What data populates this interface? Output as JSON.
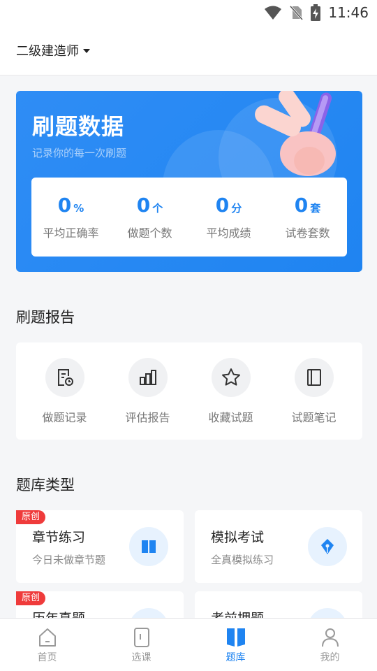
{
  "status_bar": {
    "time": "11:46",
    "icons": [
      "wifi-icon",
      "no-sim-icon",
      "battery-charging-icon"
    ]
  },
  "header": {
    "exam_name": "二级建造师"
  },
  "hero": {
    "title": "刷题数据",
    "subtitle": "记录你的每一次刷题",
    "stats": [
      {
        "value": "0",
        "unit": "%",
        "label": "平均正确率"
      },
      {
        "value": "0",
        "unit": "个",
        "label": "做题个数"
      },
      {
        "value": "0",
        "unit": "分",
        "label": "平均成绩"
      },
      {
        "value": "0",
        "unit": "套",
        "label": "试卷套数"
      }
    ]
  },
  "report": {
    "title": "刷题报告",
    "items": [
      {
        "label": "做题记录",
        "icon": "record-icon"
      },
      {
        "label": "评估报告",
        "icon": "bar-chart-icon"
      },
      {
        "label": "收藏试题",
        "icon": "star-icon"
      },
      {
        "label": "试题笔记",
        "icon": "notebook-icon"
      }
    ]
  },
  "bank_types": {
    "title": "题库类型",
    "cards": [
      {
        "title": "章节练习",
        "desc": "今日未做章节题",
        "tag": "原创",
        "icon": "book-icon"
      },
      {
        "title": "模拟考试",
        "desc": "全真模拟练习",
        "tag": "",
        "icon": "pen-nib-icon"
      },
      {
        "title": "历年真题",
        "desc": "",
        "tag": "原创",
        "icon": "history-icon"
      },
      {
        "title": "考前押题",
        "desc": "",
        "tag": "",
        "icon": "target-icon"
      }
    ]
  },
  "tabbar": {
    "accent": "#1f84f1",
    "tabs": [
      {
        "label": "首页",
        "icon": "home-icon",
        "active": false
      },
      {
        "label": "选课",
        "icon": "course-icon",
        "active": false
      },
      {
        "label": "题库",
        "icon": "question-bank-icon",
        "active": true
      },
      {
        "label": "我的",
        "icon": "profile-icon",
        "active": false
      }
    ]
  }
}
